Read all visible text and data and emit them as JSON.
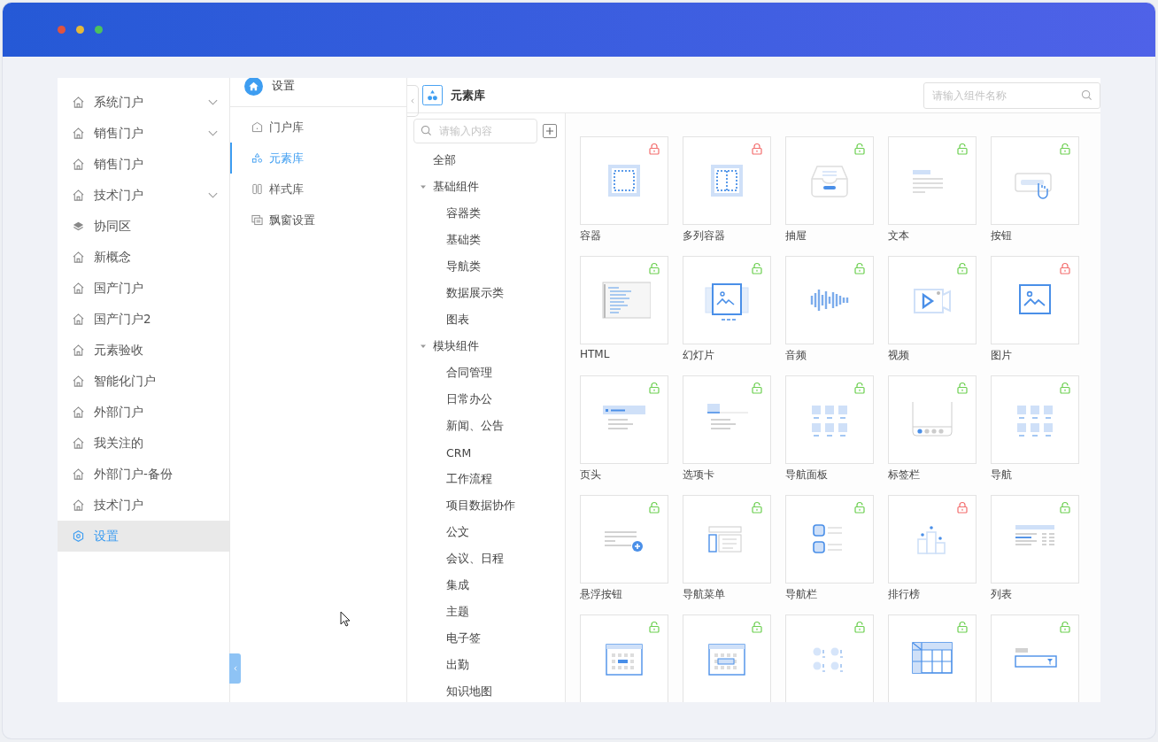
{
  "sidebar": {
    "items": [
      {
        "label": "系统门户",
        "kind": "group",
        "expanded": false,
        "selected": false
      },
      {
        "label": "销售门户",
        "kind": "group",
        "expanded": false,
        "selected": false
      },
      {
        "label": "销售门户",
        "kind": "portal",
        "selected": false
      },
      {
        "label": "技术门户",
        "kind": "group",
        "expanded": false,
        "selected": false
      },
      {
        "label": "协同区",
        "kind": "space",
        "selected": false
      },
      {
        "label": "新概念",
        "kind": "portal",
        "selected": false
      },
      {
        "label": "国产门户",
        "kind": "portal",
        "selected": false
      },
      {
        "label": "国产门户2",
        "kind": "portal",
        "selected": false
      },
      {
        "label": "元素验收",
        "kind": "portal",
        "selected": false
      },
      {
        "label": "智能化门户",
        "kind": "portal",
        "selected": false
      },
      {
        "label": "外部门户",
        "kind": "portal",
        "selected": false
      },
      {
        "label": "我关注的",
        "kind": "portal",
        "selected": false
      },
      {
        "label": "外部门户-备份",
        "kind": "portal",
        "selected": false
      },
      {
        "label": "技术门户",
        "kind": "portal",
        "selected": false
      },
      {
        "label": "设置",
        "kind": "settings",
        "selected": true
      }
    ]
  },
  "settings_menu": {
    "title": "设置",
    "items": [
      {
        "label": "门户库",
        "kind": "portal",
        "selected": false
      },
      {
        "label": "元素库",
        "kind": "element",
        "selected": true
      },
      {
        "label": "样式库",
        "kind": "style",
        "selected": false
      },
      {
        "label": "飘窗设置",
        "kind": "popup",
        "selected": false
      }
    ]
  },
  "library": {
    "title": "元素库",
    "search": {
      "placeholder": "请输入组件名称"
    }
  },
  "tree": {
    "search": {
      "placeholder": "请输入内容"
    },
    "nodes": [
      {
        "label": "全部"
      },
      {
        "label": "基础组件",
        "expanded": true,
        "children": [
          {
            "label": "容器类"
          },
          {
            "label": "基础类"
          },
          {
            "label": "导航类"
          },
          {
            "label": "数据展示类"
          },
          {
            "label": "图表"
          }
        ]
      },
      {
        "label": "模块组件",
        "expanded": true,
        "children": [
          {
            "label": "合同管理"
          },
          {
            "label": "日常办公"
          },
          {
            "label": "新闻、公告"
          },
          {
            "label": "CRM"
          },
          {
            "label": "工作流程"
          },
          {
            "label": "项目数据协作"
          },
          {
            "label": "公文"
          },
          {
            "label": "会议、日程"
          },
          {
            "label": "集成"
          },
          {
            "label": "主题"
          },
          {
            "label": "电子签"
          },
          {
            "label": "出勤"
          },
          {
            "label": "知识地图"
          }
        ]
      }
    ]
  },
  "components": [
    {
      "label": "容器",
      "kind": "container",
      "locked": true
    },
    {
      "label": "多列容器",
      "kind": "columns",
      "locked": true
    },
    {
      "label": "抽屉",
      "kind": "drawer",
      "locked": false
    },
    {
      "label": "文本",
      "kind": "text",
      "locked": false
    },
    {
      "label": "按钮",
      "kind": "button",
      "locked": false
    },
    {
      "label": "HTML",
      "kind": "html",
      "locked": false
    },
    {
      "label": "幻灯片",
      "kind": "slides",
      "locked": false
    },
    {
      "label": "音频",
      "kind": "audio",
      "locked": false
    },
    {
      "label": "视频",
      "kind": "video",
      "locked": false
    },
    {
      "label": "图片",
      "kind": "image",
      "locked": true
    },
    {
      "label": "页头",
      "kind": "header",
      "locked": false
    },
    {
      "label": "选项卡",
      "kind": "tabs",
      "locked": false
    },
    {
      "label": "导航面板",
      "kind": "grid",
      "locked": false
    },
    {
      "label": "标签栏",
      "kind": "tabbar",
      "locked": false
    },
    {
      "label": "导航",
      "kind": "grid",
      "locked": false
    },
    {
      "label": "悬浮按钮",
      "kind": "float",
      "locked": false
    },
    {
      "label": "导航菜单",
      "kind": "navmenu",
      "locked": false
    },
    {
      "label": "导航栏",
      "kind": "navbar",
      "locked": false
    },
    {
      "label": "排行榜",
      "kind": "ranking",
      "locked": true
    },
    {
      "label": "列表",
      "kind": "list",
      "locked": false
    },
    {
      "kind": "calendar",
      "locked": false
    },
    {
      "kind": "datepicker",
      "locked": false
    },
    {
      "kind": "steps",
      "locked": false
    },
    {
      "kind": "table",
      "locked": false
    },
    {
      "kind": "filter",
      "locked": false
    }
  ]
}
